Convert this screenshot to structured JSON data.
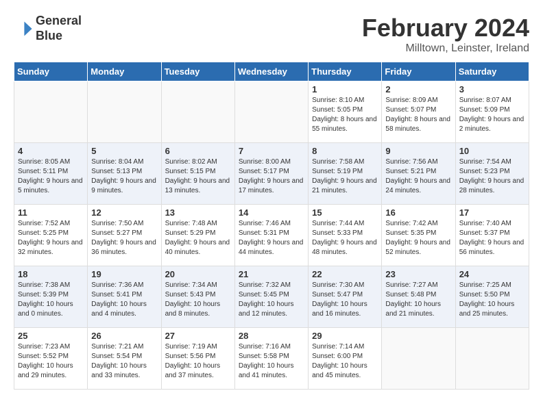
{
  "header": {
    "logo_line1": "General",
    "logo_line2": "Blue",
    "title": "February 2024",
    "subtitle": "Milltown, Leinster, Ireland"
  },
  "days_of_week": [
    "Sunday",
    "Monday",
    "Tuesday",
    "Wednesday",
    "Thursday",
    "Friday",
    "Saturday"
  ],
  "weeks": [
    [
      {
        "day": "",
        "info": ""
      },
      {
        "day": "",
        "info": ""
      },
      {
        "day": "",
        "info": ""
      },
      {
        "day": "",
        "info": ""
      },
      {
        "day": "1",
        "info": "Sunrise: 8:10 AM\nSunset: 5:05 PM\nDaylight: 8 hours and 55 minutes."
      },
      {
        "day": "2",
        "info": "Sunrise: 8:09 AM\nSunset: 5:07 PM\nDaylight: 8 hours and 58 minutes."
      },
      {
        "day": "3",
        "info": "Sunrise: 8:07 AM\nSunset: 5:09 PM\nDaylight: 9 hours and 2 minutes."
      }
    ],
    [
      {
        "day": "4",
        "info": "Sunrise: 8:05 AM\nSunset: 5:11 PM\nDaylight: 9 hours and 5 minutes."
      },
      {
        "day": "5",
        "info": "Sunrise: 8:04 AM\nSunset: 5:13 PM\nDaylight: 9 hours and 9 minutes."
      },
      {
        "day": "6",
        "info": "Sunrise: 8:02 AM\nSunset: 5:15 PM\nDaylight: 9 hours and 13 minutes."
      },
      {
        "day": "7",
        "info": "Sunrise: 8:00 AM\nSunset: 5:17 PM\nDaylight: 9 hours and 17 minutes."
      },
      {
        "day": "8",
        "info": "Sunrise: 7:58 AM\nSunset: 5:19 PM\nDaylight: 9 hours and 21 minutes."
      },
      {
        "day": "9",
        "info": "Sunrise: 7:56 AM\nSunset: 5:21 PM\nDaylight: 9 hours and 24 minutes."
      },
      {
        "day": "10",
        "info": "Sunrise: 7:54 AM\nSunset: 5:23 PM\nDaylight: 9 hours and 28 minutes."
      }
    ],
    [
      {
        "day": "11",
        "info": "Sunrise: 7:52 AM\nSunset: 5:25 PM\nDaylight: 9 hours and 32 minutes."
      },
      {
        "day": "12",
        "info": "Sunrise: 7:50 AM\nSunset: 5:27 PM\nDaylight: 9 hours and 36 minutes."
      },
      {
        "day": "13",
        "info": "Sunrise: 7:48 AM\nSunset: 5:29 PM\nDaylight: 9 hours and 40 minutes."
      },
      {
        "day": "14",
        "info": "Sunrise: 7:46 AM\nSunset: 5:31 PM\nDaylight: 9 hours and 44 minutes."
      },
      {
        "day": "15",
        "info": "Sunrise: 7:44 AM\nSunset: 5:33 PM\nDaylight: 9 hours and 48 minutes."
      },
      {
        "day": "16",
        "info": "Sunrise: 7:42 AM\nSunset: 5:35 PM\nDaylight: 9 hours and 52 minutes."
      },
      {
        "day": "17",
        "info": "Sunrise: 7:40 AM\nSunset: 5:37 PM\nDaylight: 9 hours and 56 minutes."
      }
    ],
    [
      {
        "day": "18",
        "info": "Sunrise: 7:38 AM\nSunset: 5:39 PM\nDaylight: 10 hours and 0 minutes."
      },
      {
        "day": "19",
        "info": "Sunrise: 7:36 AM\nSunset: 5:41 PM\nDaylight: 10 hours and 4 minutes."
      },
      {
        "day": "20",
        "info": "Sunrise: 7:34 AM\nSunset: 5:43 PM\nDaylight: 10 hours and 8 minutes."
      },
      {
        "day": "21",
        "info": "Sunrise: 7:32 AM\nSunset: 5:45 PM\nDaylight: 10 hours and 12 minutes."
      },
      {
        "day": "22",
        "info": "Sunrise: 7:30 AM\nSunset: 5:47 PM\nDaylight: 10 hours and 16 minutes."
      },
      {
        "day": "23",
        "info": "Sunrise: 7:27 AM\nSunset: 5:48 PM\nDaylight: 10 hours and 21 minutes."
      },
      {
        "day": "24",
        "info": "Sunrise: 7:25 AM\nSunset: 5:50 PM\nDaylight: 10 hours and 25 minutes."
      }
    ],
    [
      {
        "day": "25",
        "info": "Sunrise: 7:23 AM\nSunset: 5:52 PM\nDaylight: 10 hours and 29 minutes."
      },
      {
        "day": "26",
        "info": "Sunrise: 7:21 AM\nSunset: 5:54 PM\nDaylight: 10 hours and 33 minutes."
      },
      {
        "day": "27",
        "info": "Sunrise: 7:19 AM\nSunset: 5:56 PM\nDaylight: 10 hours and 37 minutes."
      },
      {
        "day": "28",
        "info": "Sunrise: 7:16 AM\nSunset: 5:58 PM\nDaylight: 10 hours and 41 minutes."
      },
      {
        "day": "29",
        "info": "Sunrise: 7:14 AM\nSunset: 6:00 PM\nDaylight: 10 hours and 45 minutes."
      },
      {
        "day": "",
        "info": ""
      },
      {
        "day": "",
        "info": ""
      }
    ]
  ]
}
